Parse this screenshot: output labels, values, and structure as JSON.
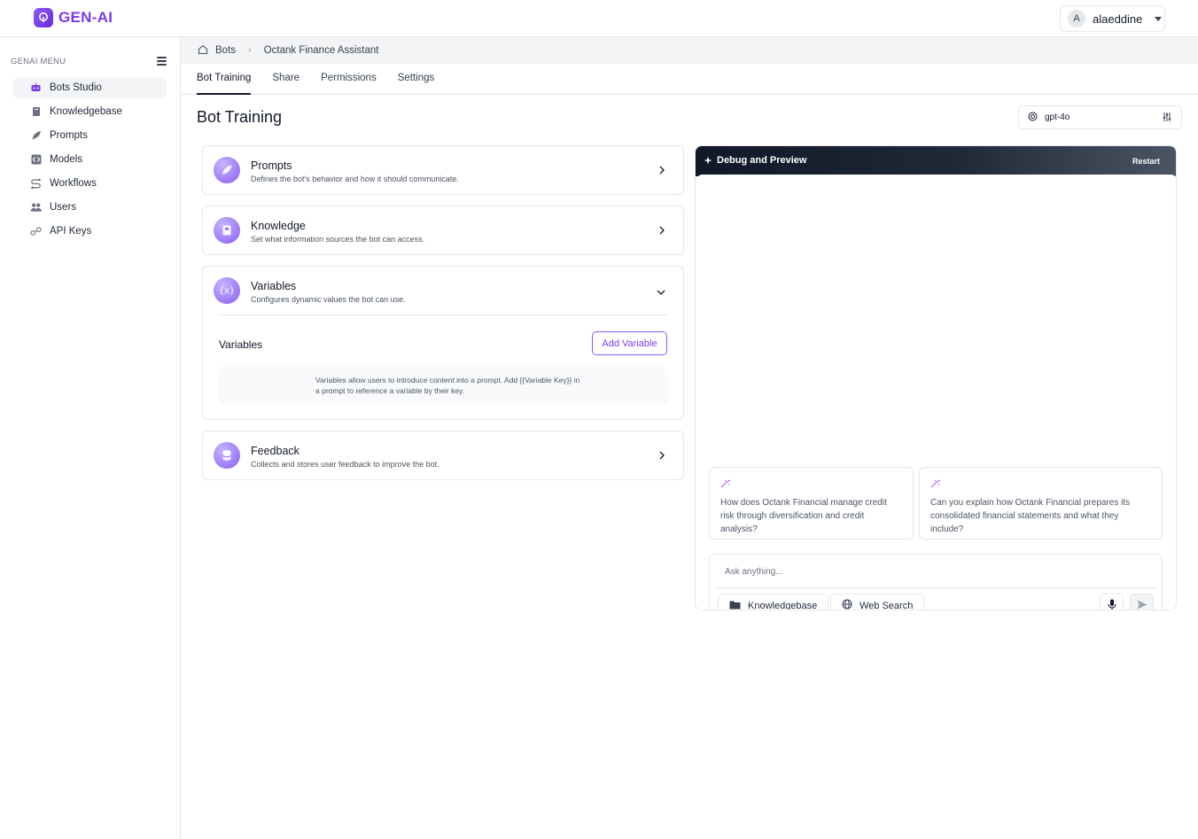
{
  "app": {
    "name": "GEN-AI"
  },
  "user": {
    "initial": "A",
    "name": "alaeddine"
  },
  "sidebar": {
    "title": "GENAI MENU",
    "items": [
      {
        "label": "Bots Studio",
        "icon": "bot-icon"
      },
      {
        "label": "Knowledgebase",
        "icon": "book-icon"
      },
      {
        "label": "Prompts",
        "icon": "feather-icon"
      },
      {
        "label": "Models",
        "icon": "code-icon"
      },
      {
        "label": "Workflows",
        "icon": "workflow-icon"
      },
      {
        "label": "Users",
        "icon": "users-icon"
      },
      {
        "label": "API Keys",
        "icon": "key-icon"
      }
    ]
  },
  "breadcrumb": {
    "root": "Bots",
    "current": "Octank Finance Assistant"
  },
  "tabs": [
    "Bot Training",
    "Share",
    "Permissions",
    "Settings"
  ],
  "page": {
    "title": "Bot Training"
  },
  "model": {
    "value": "gpt-4o"
  },
  "cards": {
    "prompts": {
      "title": "Prompts",
      "desc": "Defines the bot's behavior and how it should communicate."
    },
    "knowledge": {
      "title": "Knowledge",
      "desc": "Set what information sources the bot can access."
    },
    "variables": {
      "title": "Variables",
      "desc": "Configures dynamic values the bot can use.",
      "section_label": "Variables",
      "add_label": "Add Variable",
      "hint": "Variables allow users to introduce content into a prompt. Add {{Variable Key}} in a prompt to reference a variable by their key."
    },
    "feedback": {
      "title": "Feedback",
      "desc": "Collects and stores user feedback to improve the bot."
    }
  },
  "debug": {
    "title": "Debug and Preview",
    "restart_label": "Restart",
    "suggestions": [
      "How does Octank Financial manage credit risk through diversification and credit analysis?",
      "Can you explain how Octank Financial prepares its consolidated financial statements and what they include?"
    ],
    "input_placeholder": "Ask anything...",
    "knowledgebase_label": "Knowledgebase",
    "websearch_label": "Web Search"
  },
  "colors": {
    "accent": "#7c3aed",
    "accent_light": "#8b5cf6"
  }
}
